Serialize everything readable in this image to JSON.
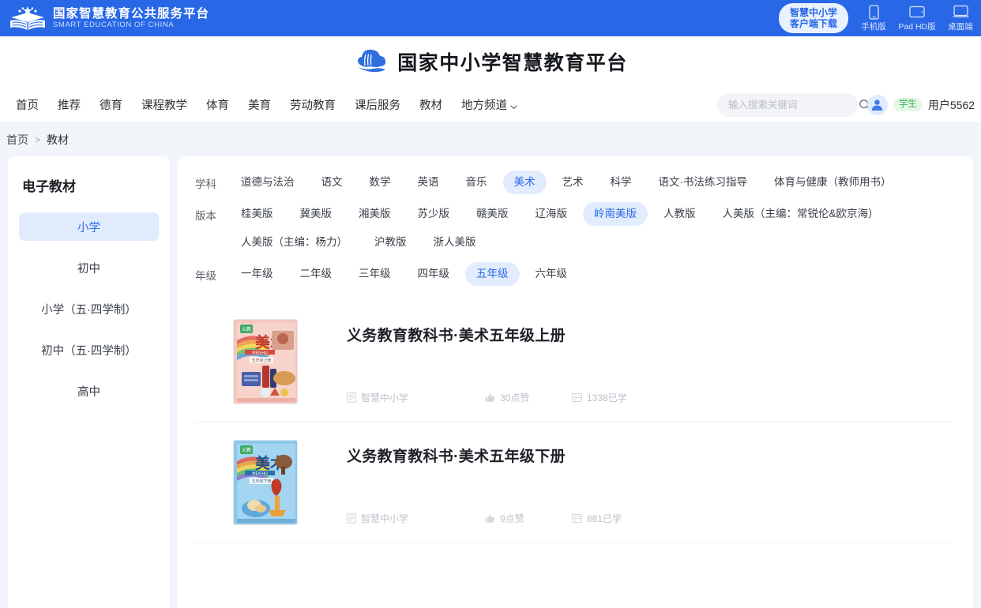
{
  "topbar": {
    "gov_title_cn": "国家智慧教育公共服务平台",
    "gov_title_en": "SMART EDUCATION OF CHINA",
    "client_download_line1": "智慧中小学",
    "client_download_line2": "客户端下载",
    "devices": [
      {
        "label": "手机版",
        "icon": "phone-icon"
      },
      {
        "label": "Pad HD版",
        "icon": "tablet-icon"
      },
      {
        "label": "桌面端",
        "icon": "desktop-icon"
      }
    ],
    "accent_color": "#2867e6"
  },
  "brand": {
    "title": "国家中小学智慧教育平台",
    "logo_icon": "cloud-book-logo"
  },
  "nav": {
    "items": [
      {
        "label": "首页"
      },
      {
        "label": "推荐"
      },
      {
        "label": "德育"
      },
      {
        "label": "课程教学"
      },
      {
        "label": "体育"
      },
      {
        "label": "美育"
      },
      {
        "label": "劳动教育"
      },
      {
        "label": "课后服务"
      },
      {
        "label": "教材"
      },
      {
        "label": "地方频道",
        "has_caret": true
      }
    ]
  },
  "search": {
    "placeholder": "输入搜索关键词",
    "value": "",
    "icon": "search-icon"
  },
  "user": {
    "role_badge": "学生",
    "name": "用户5562",
    "avatar_icon": "user-avatar-icon"
  },
  "breadcrumb": {
    "home": "首页",
    "separator": ">",
    "current": "教材"
  },
  "sidebar": {
    "title": "电子教材",
    "items": [
      {
        "label": "小学",
        "active": true
      },
      {
        "label": "初中",
        "active": false
      },
      {
        "label": "小学（五·四学制）",
        "active": false
      },
      {
        "label": "初中（五·四学制）",
        "active": false
      },
      {
        "label": "高中",
        "active": false
      }
    ]
  },
  "filters": [
    {
      "label": "学科",
      "options": [
        "道德与法治",
        "语文",
        "数学",
        "英语",
        "音乐",
        "美术",
        "艺术",
        "科学",
        "语文·书法练习指导",
        "体育与健康（教师用书）"
      ],
      "selected": "美术"
    },
    {
      "label": "版本",
      "options": [
        "桂美版",
        "冀美版",
        "湘美版",
        "苏少版",
        "赣美版",
        "辽海版",
        "岭南美版",
        "人教版",
        "人美版（主编：常锐伦&欧京海）",
        "人美版（主编：杨力）",
        "沪教版",
        "浙人美版"
      ],
      "selected": "岭南美版"
    },
    {
      "label": "年级",
      "options": [
        "一年级",
        "二年级",
        "三年级",
        "四年级",
        "五年级",
        "六年级"
      ],
      "selected": "五年级"
    }
  ],
  "books": [
    {
      "title": "义务教育教科书·美术五年级上册",
      "source": "智慧中小学",
      "likes": "30点赞",
      "studied": "1338已学",
      "cover": {
        "background": "#f3bfb6",
        "label_cn": "美术",
        "label_en": "MEISHU",
        "sub": "五年级上册",
        "accent": "#e8776a"
      }
    },
    {
      "title": "义务教育教科书·美术五年级下册",
      "source": "智慧中小学",
      "likes": "9点赞",
      "studied": "881已学",
      "cover": {
        "background": "#7fc0e8",
        "label_cn": "美术",
        "label_en": "MEISHU",
        "sub": "五年级下册",
        "accent": "#2f8dc8"
      }
    }
  ],
  "icons": {
    "source": "book-source-icon",
    "likes": "thumbs-up-icon",
    "studied": "studied-icon"
  }
}
